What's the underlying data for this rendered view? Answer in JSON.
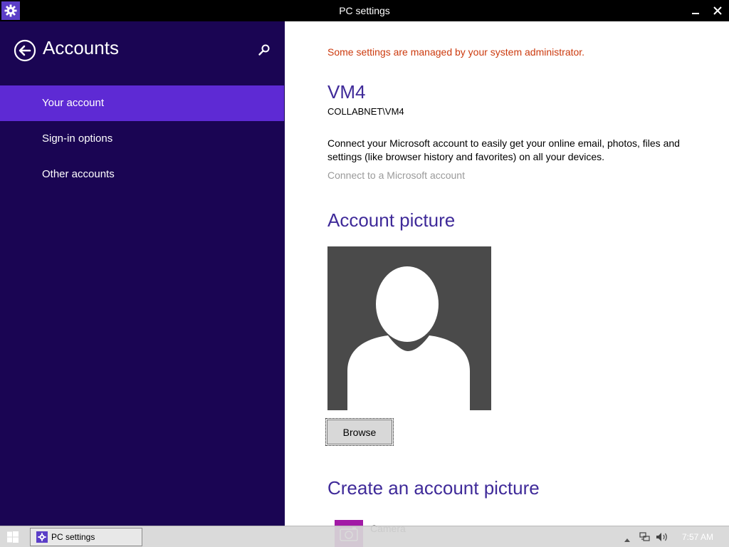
{
  "window": {
    "title": "PC settings",
    "icon": "gear-icon",
    "controls": [
      "minimize-icon",
      "close-icon"
    ]
  },
  "sidebar": {
    "title": "Accounts",
    "back_icon": "back-arrow-icon",
    "search_icon": "search-icon",
    "items": [
      {
        "label": "Your account",
        "selected": true
      },
      {
        "label": "Sign-in options",
        "selected": false
      },
      {
        "label": "Other accounts",
        "selected": false
      }
    ]
  },
  "main": {
    "admin_notice": "Some settings are managed by your system administrator.",
    "user_name": "VM4",
    "domain_user": "COLLABNET\\VM4",
    "connect_description": "Connect your Microsoft account to easily get your online email, photos, files and settings (like browser history and favorites) on all your devices.",
    "connect_link": "Connect to a Microsoft account",
    "account_picture_heading": "Account picture",
    "browse_label": "Browse",
    "create_picture_heading": "Create an account picture",
    "camera_label": "Camera"
  },
  "taskbar": {
    "task_label": "PC settings",
    "clock": "7:57 AM"
  },
  "colors": {
    "sidebar_bg": "#1a0553",
    "selected_item": "#5e2ad4",
    "heading": "#3f2a99",
    "admin_notice": "#cc3a0e",
    "camera_tile": "#a21aa6"
  }
}
